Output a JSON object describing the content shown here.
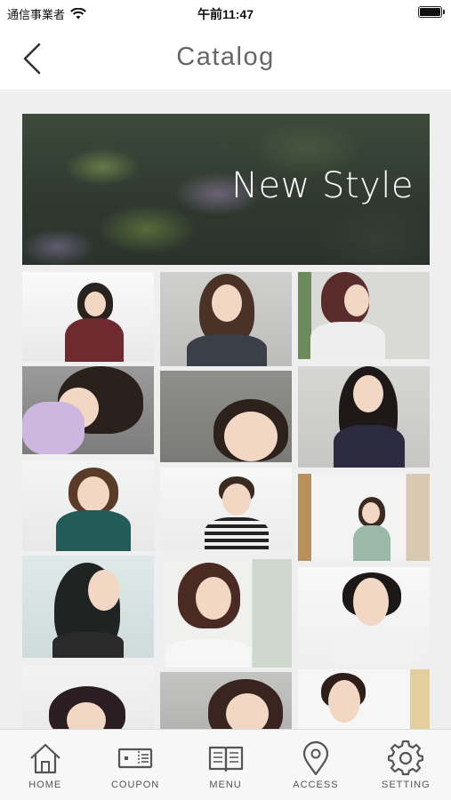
{
  "status_bar": {
    "carrier": "通信事業者",
    "time": "午前11:47"
  },
  "nav": {
    "title": "Catalog"
  },
  "banner": {
    "text": "New Style"
  },
  "tabs": [
    {
      "label": "HOME",
      "icon": "home-icon"
    },
    {
      "label": "COUPON",
      "icon": "coupon-icon"
    },
    {
      "label": "MENU",
      "icon": "menu-book-icon"
    },
    {
      "label": "ACCESS",
      "icon": "map-pin-icon"
    },
    {
      "label": "SETTING",
      "icon": "gear-icon"
    }
  ],
  "colors": {
    "background": "#efefef",
    "nav_text": "#666666",
    "tab_text": "#555555"
  }
}
